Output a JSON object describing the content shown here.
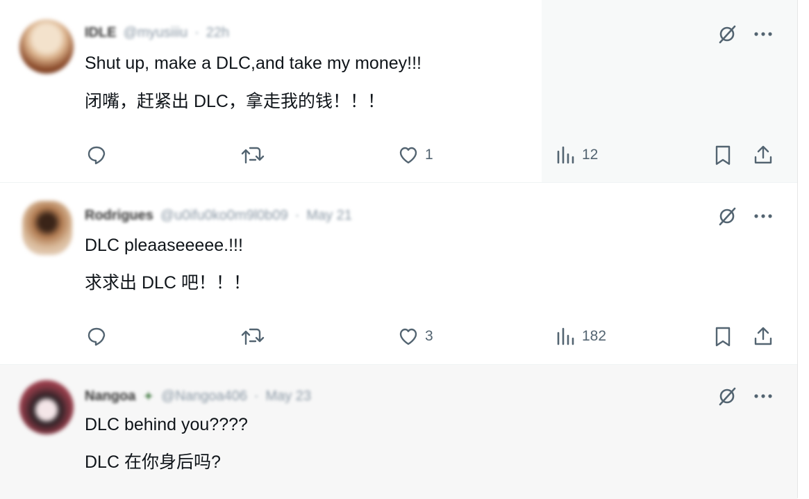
{
  "tweets": [
    {
      "name": "IDLE",
      "handle": "@myusiiiu",
      "time": "22h",
      "text_en": "Shut up, make a DLC,and take my money!!!",
      "text_zh": "闭嘴，赶紧出 DLC，拿走我的钱！！！",
      "likes": "1",
      "views": "12"
    },
    {
      "name": "Rodrigues",
      "handle": "@u0ifu0ko0m9l0b09",
      "time": "May 21",
      "text_en": "DLC pleaaseeeee.!!!",
      "text_zh": "求求出 DLC 吧！！！",
      "likes": "3",
      "views": "182"
    },
    {
      "name": "Nangoa",
      "handle": "@Nangoa406",
      "time": "May 23",
      "text_en": "DLC behind you????",
      "text_zh": "DLC 在你身后吗?",
      "likes": "",
      "views": ""
    }
  ],
  "icons": {
    "grok": "grok-slash-icon",
    "more": "more-icon",
    "reply": "reply-icon",
    "retweet": "retweet-icon",
    "like": "heart-icon",
    "views": "views-icon",
    "bookmark": "bookmark-icon",
    "share": "share-icon"
  },
  "colors": {
    "icon": "#536471",
    "text": "#0f1419",
    "hover_bg": "#f7f9f9"
  }
}
